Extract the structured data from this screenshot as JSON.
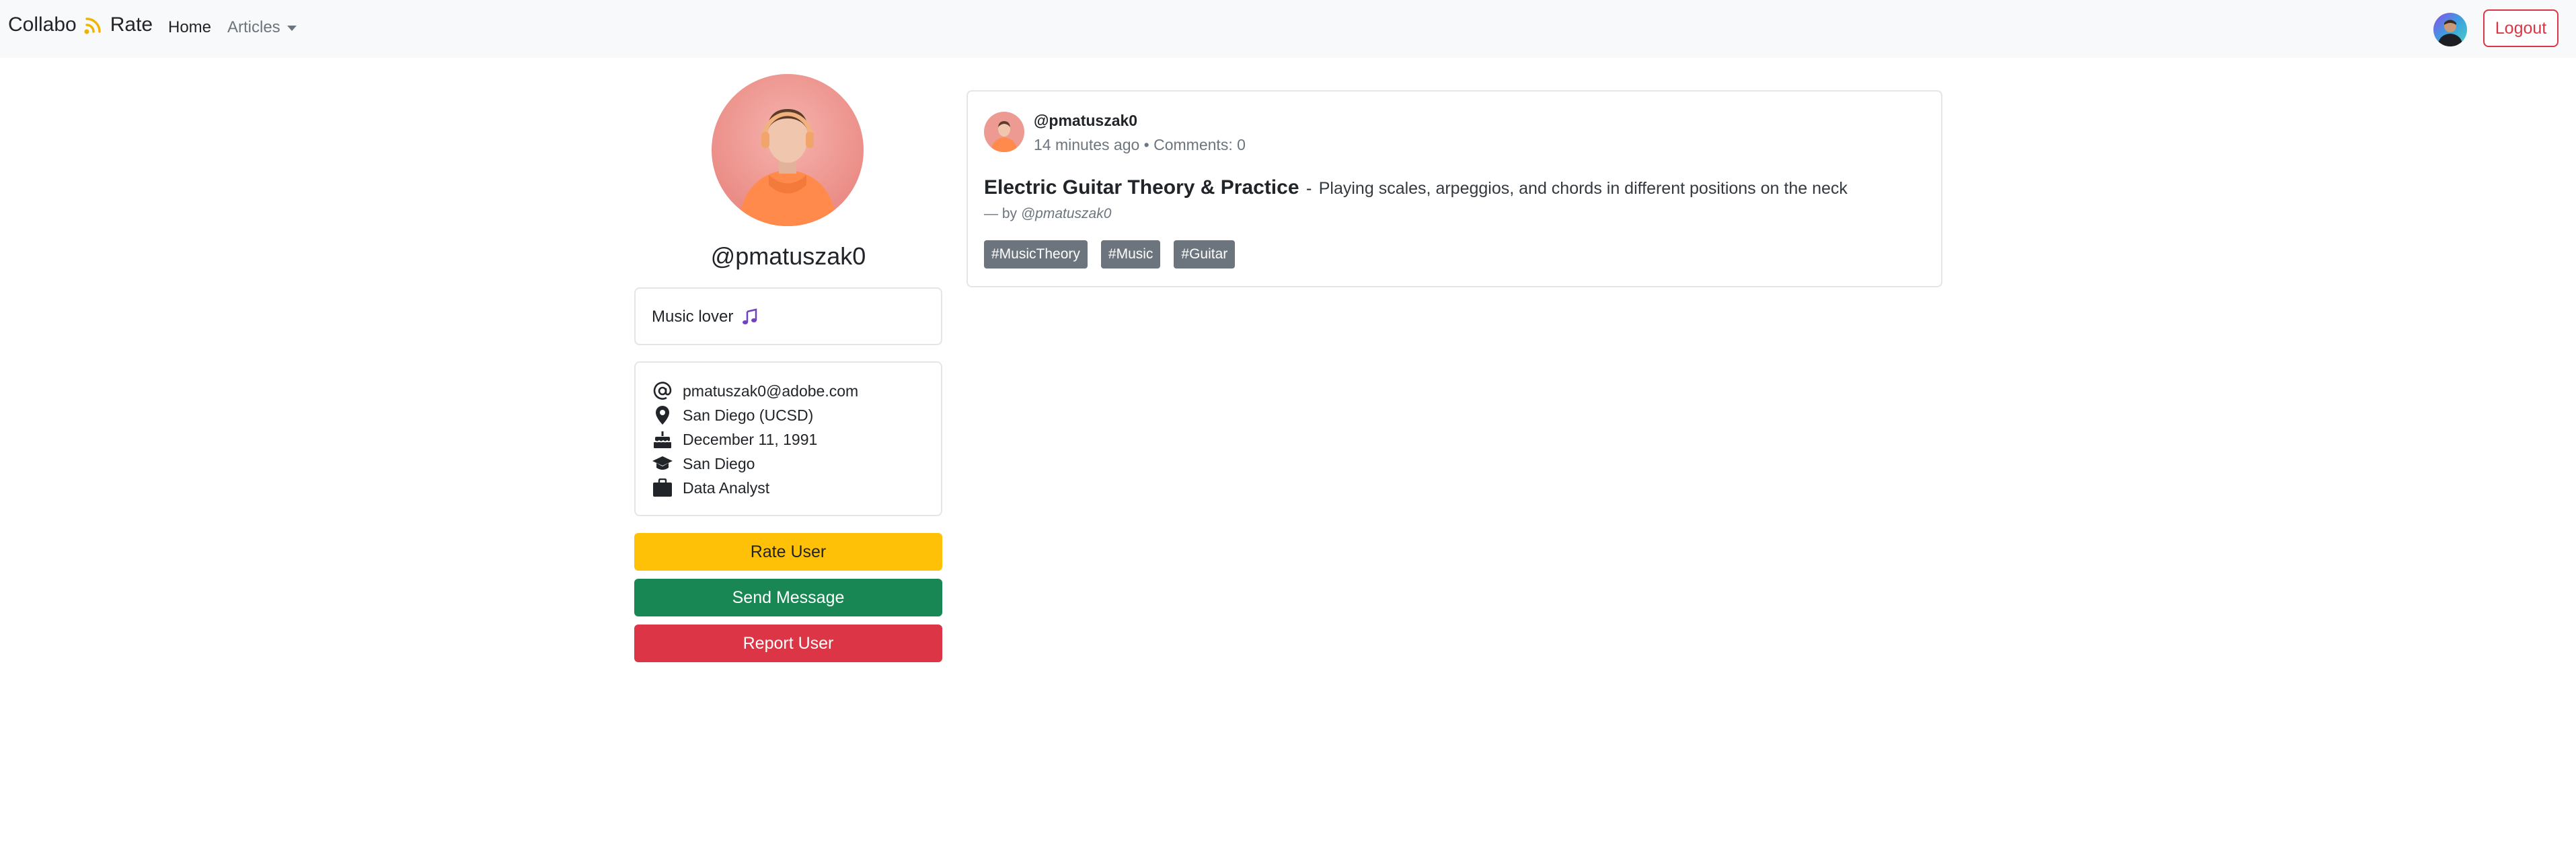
{
  "navbar": {
    "brand_left": "Collabo",
    "brand_right": "Rate",
    "home_label": "Home",
    "articles_label": "Articles",
    "logout_label": "Logout"
  },
  "profile": {
    "username": "@pmatuszak0",
    "bio": "Music lover",
    "info": [
      {
        "icon": "at-sign-icon",
        "value": "pmatuszak0@adobe.com"
      },
      {
        "icon": "location-pin-icon",
        "value": "San Diego (UCSD)"
      },
      {
        "icon": "birthday-cake-icon",
        "value": "December 11, 1991"
      },
      {
        "icon": "graduation-cap-icon",
        "value": "San Diego"
      },
      {
        "icon": "briefcase-icon",
        "value": "Data Analyst"
      }
    ],
    "actions": {
      "rate_label": "Rate User",
      "message_label": "Send Message",
      "report_label": "Report User"
    }
  },
  "article": {
    "author": "@pmatuszak0",
    "time_ago": "14 minutes ago",
    "comments": "Comments: 0",
    "title": "Electric Guitar Theory & Practice",
    "separator": "-",
    "description": "Playing scales, arpeggios, and chords in different positions on the neck",
    "byline_prefix": "— by",
    "byline_user": "@pmatuszak0",
    "tags": [
      "#MusicTheory",
      "#Music",
      "#Guitar"
    ]
  },
  "colors": {
    "warning": "#ffc107",
    "success": "#198754",
    "danger": "#dc3545",
    "secondary": "#6c757d",
    "music_icon": "#6f42c1"
  }
}
